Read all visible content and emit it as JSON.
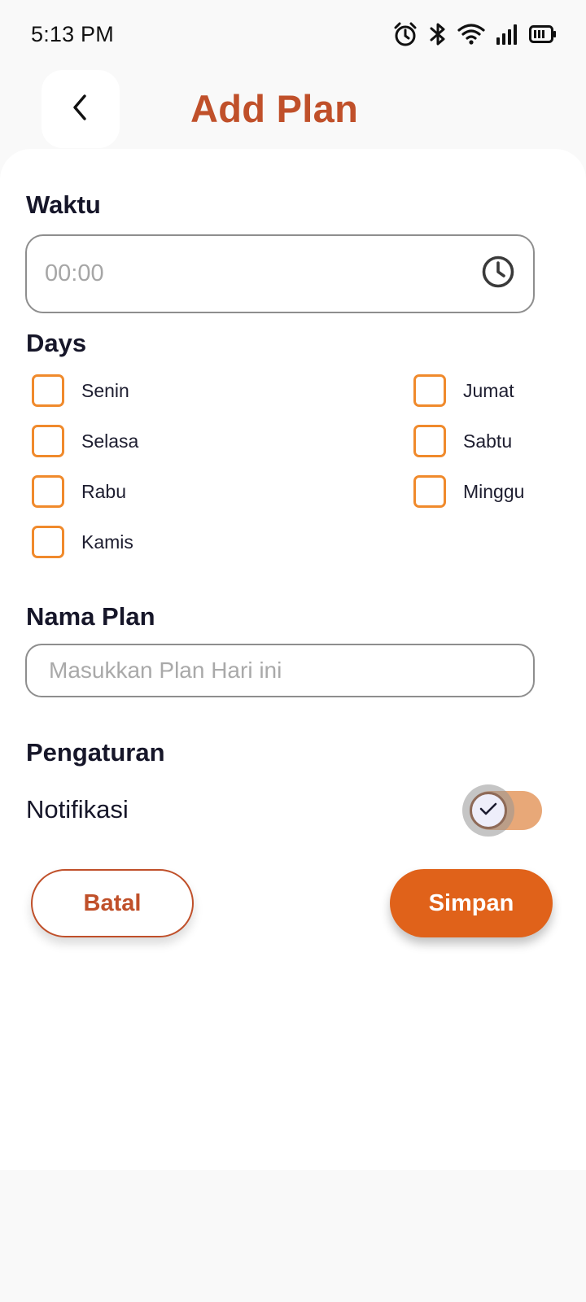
{
  "status_bar": {
    "time": "5:13 PM",
    "icons": [
      "alarm-icon",
      "bluetooth-icon",
      "wifi-icon",
      "signal-icon",
      "battery-icon"
    ]
  },
  "header": {
    "title": "Add Plan",
    "back_icon": "chevron-left-icon"
  },
  "form": {
    "time_label": "Waktu",
    "time_placeholder": "00:00",
    "days_label": "Days",
    "days": [
      {
        "label": "Senin",
        "checked": false
      },
      {
        "label": "Selasa",
        "checked": false
      },
      {
        "label": "Rabu",
        "checked": false
      },
      {
        "label": "Kamis",
        "checked": false
      },
      {
        "label": "Jumat",
        "checked": false
      },
      {
        "label": "Sabtu",
        "checked": false
      },
      {
        "label": "Minggu",
        "checked": false
      }
    ],
    "plan_label": "Nama Plan",
    "plan_placeholder": "Masukkan Plan Hari ini",
    "settings_label": "Pengaturan",
    "notification_label": "Notifikasi",
    "notification_enabled": true
  },
  "actions": {
    "cancel_label": "Batal",
    "save_label": "Simpan"
  },
  "colors": {
    "accent": "#c0502a",
    "primary_button": "#e0621a",
    "checkbox_border": "#f08a2c",
    "toggle_track": "#e8a878"
  }
}
